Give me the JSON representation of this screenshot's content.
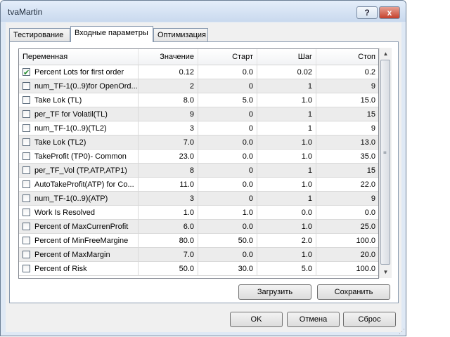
{
  "window": {
    "title": "tvaMartin",
    "help_label": "?",
    "close_label": "x"
  },
  "tabs": [
    {
      "label": "Тестирование",
      "active": false
    },
    {
      "label": "Входные параметры",
      "active": true
    },
    {
      "label": "Оптимизация",
      "active": false
    }
  ],
  "grid": {
    "columns": [
      "Переменная",
      "Значение",
      "Старт",
      "Шаг",
      "Стоп"
    ],
    "rows": [
      {
        "checked": true,
        "name": "Percent Lots for first order",
        "value": "0.12",
        "start": "0.0",
        "step": "0.02",
        "stop": "0.2"
      },
      {
        "checked": false,
        "name": "num_TF-1(0..9)for OpenOrd...",
        "value": "2",
        "start": "0",
        "step": "1",
        "stop": "9"
      },
      {
        "checked": false,
        "name": "Take Lok (TL)",
        "value": "8.0",
        "start": "5.0",
        "step": "1.0",
        "stop": "15.0"
      },
      {
        "checked": false,
        "name": "per_TF for Volatil(TL)",
        "value": "9",
        "start": "0",
        "step": "1",
        "stop": "15"
      },
      {
        "checked": false,
        "name": "num_TF-1(0..9)(TL2)",
        "value": "3",
        "start": "0",
        "step": "1",
        "stop": "9"
      },
      {
        "checked": false,
        "name": "Take Lok (TL2)",
        "value": "7.0",
        "start": "0.0",
        "step": "1.0",
        "stop": "13.0"
      },
      {
        "checked": false,
        "name": "TakeProfit (TP0)- Common",
        "value": "23.0",
        "start": "0.0",
        "step": "1.0",
        "stop": "35.0"
      },
      {
        "checked": false,
        "name": "per_TF_Vol (TP,ATP,ATP1)",
        "value": "8",
        "start": "0",
        "step": "1",
        "stop": "15"
      },
      {
        "checked": false,
        "name": "AutoTakeProfit(ATP) for Co...",
        "value": "11.0",
        "start": "0.0",
        "step": "1.0",
        "stop": "22.0"
      },
      {
        "checked": false,
        "name": "num_TF-1(0..9)(ATP)",
        "value": "3",
        "start": "0",
        "step": "1",
        "stop": "9"
      },
      {
        "checked": false,
        "name": "Work Is Resolved",
        "value": "1.0",
        "start": "1.0",
        "step": "0.0",
        "stop": "0.0"
      },
      {
        "checked": false,
        "name": "Percent of MaxCurrenProfit",
        "value": "6.0",
        "start": "0.0",
        "step": "1.0",
        "stop": "25.0"
      },
      {
        "checked": false,
        "name": "Percent of MinFreeMargine",
        "value": "80.0",
        "start": "50.0",
        "step": "2.0",
        "stop": "100.0"
      },
      {
        "checked": false,
        "name": "Percent of MaxMargin",
        "value": "7.0",
        "start": "0.0",
        "step": "1.0",
        "stop": "20.0"
      },
      {
        "checked": false,
        "name": "Percent of Risk",
        "value": "50.0",
        "start": "30.0",
        "step": "5.0",
        "stop": "100.0"
      }
    ]
  },
  "scrollbar": {
    "up_icon": "▲",
    "down_icon": "▼",
    "grip_icon": "≡"
  },
  "panel_buttons": {
    "load": "Загрузить",
    "save": "Сохранить"
  },
  "dialog_buttons": {
    "ok": "OK",
    "cancel": "Отмена",
    "reset": "Сброс"
  }
}
